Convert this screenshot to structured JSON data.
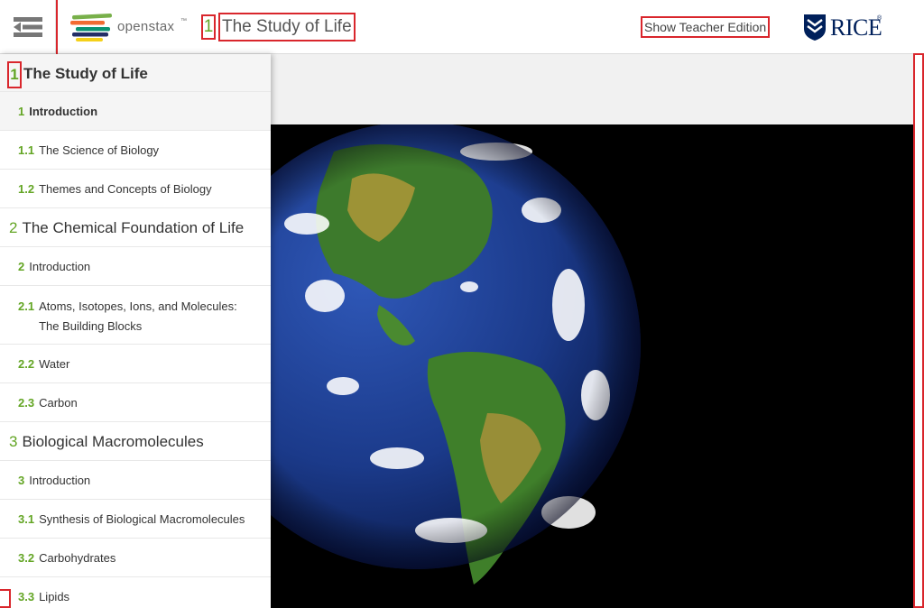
{
  "header": {
    "menu_icon": "hamburger-close-icon",
    "logo_text": "openstax",
    "logo_tm": "™",
    "chapter_number": "1",
    "chapter_title": "The Study of Life",
    "teacher_button": "Show Teacher Edition",
    "rice_logo_text": "RICE",
    "rice_tm": "®",
    "colors": {
      "accent_green": "#63a524",
      "rice_navy": "#00205b",
      "highlight_red": "#d9262c"
    }
  },
  "toc": {
    "current_chapter": {
      "num": "1",
      "title": "The Study of Life"
    },
    "items": [
      {
        "type": "section",
        "num": "1",
        "label": "Introduction",
        "active": true
      },
      {
        "type": "section",
        "num": "1.1",
        "label": "The Science of Biology"
      },
      {
        "type": "section",
        "num": "1.2",
        "label": "Themes and Concepts of Biology"
      },
      {
        "type": "chapter",
        "num": "2",
        "label": "The Chemical Foundation of Life"
      },
      {
        "type": "section",
        "num": "2",
        "label": "Introduction"
      },
      {
        "type": "section",
        "num": "2.1",
        "label": "Atoms, Isotopes, Ions, and Molecules: The Building Blocks",
        "multiline": true
      },
      {
        "type": "section",
        "num": "2.2",
        "label": "Water"
      },
      {
        "type": "section",
        "num": "2.3",
        "label": "Carbon"
      },
      {
        "type": "chapter",
        "num": "3",
        "label": "Biological Macromolecules"
      },
      {
        "type": "section",
        "num": "3",
        "label": "Introduction"
      },
      {
        "type": "section",
        "num": "3.1",
        "label": "Synthesis of Biological Macromolecules"
      },
      {
        "type": "section",
        "num": "3.2",
        "label": "Carbohydrates"
      },
      {
        "type": "section",
        "num": "3.3",
        "label": "Lipids"
      }
    ]
  },
  "content": {
    "image": "earth-globe-americas"
  }
}
